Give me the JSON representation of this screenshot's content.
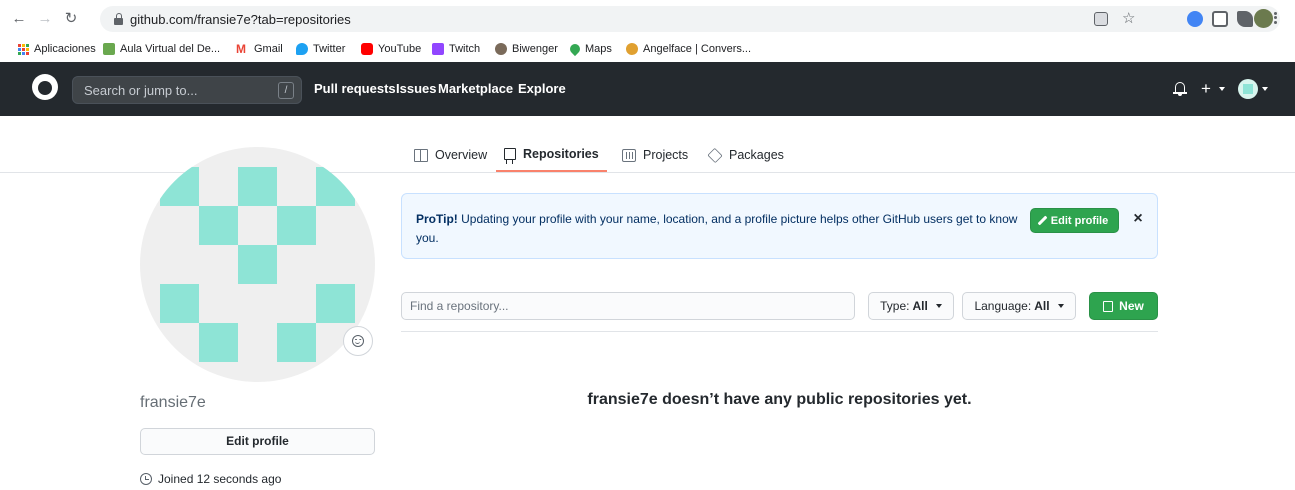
{
  "browser": {
    "url": "github.com/fransie7e?tab=repositories",
    "bookmarks": [
      {
        "label": "Aplicaciones",
        "icon": "apps-grid-icon"
      },
      {
        "label": "Aula Virtual del De...",
        "icon": "aula-virtual-icon"
      },
      {
        "label": "Gmail",
        "icon": "gmail-icon"
      },
      {
        "label": "Twitter",
        "icon": "twitter-icon"
      },
      {
        "label": "YouTube",
        "icon": "youtube-icon"
      },
      {
        "label": "Twitch",
        "icon": "twitch-icon"
      },
      {
        "label": "Biwenger",
        "icon": "biwenger-icon"
      },
      {
        "label": "Maps",
        "icon": "maps-icon"
      },
      {
        "label": "Angelface | Convers...",
        "icon": "angelface-icon"
      }
    ]
  },
  "header": {
    "search_placeholder": "Search or jump to...",
    "search_shortcut": "/",
    "nav": [
      "Pull requests",
      "Issues",
      "Marketplace",
      "Explore"
    ],
    "plus": "+"
  },
  "tabs": [
    {
      "label": "Overview",
      "icon": "book-icon",
      "selected": false
    },
    {
      "label": "Repositories",
      "icon": "repo-icon",
      "selected": true
    },
    {
      "label": "Projects",
      "icon": "project-icon",
      "selected": false
    },
    {
      "label": "Packages",
      "icon": "package-icon",
      "selected": false
    }
  ],
  "profile": {
    "username": "fransie7e",
    "edit_profile_label": "Edit profile",
    "joined": "Joined 12 seconds ago",
    "identicon_color": "#8ee4d6"
  },
  "protip": {
    "title": "ProTip!",
    "text": " Updating your profile with your name, location, and a profile picture helps other GitHub users get to know you.",
    "button_label": "Edit profile",
    "close": "×"
  },
  "repo_filter": {
    "search_placeholder": "Find a repository...",
    "type_label": "Type:",
    "type_value": "All",
    "language_label": "Language:",
    "language_value": "All",
    "new_label": "New"
  },
  "empty_state": "fransie7e doesn’t have any public repositories yet.",
  "colors": {
    "header_bg": "#24292e",
    "primary_button": "#2ea44f",
    "tab_underline": "#f9826c",
    "protip_bg": "#f1f8ff"
  }
}
